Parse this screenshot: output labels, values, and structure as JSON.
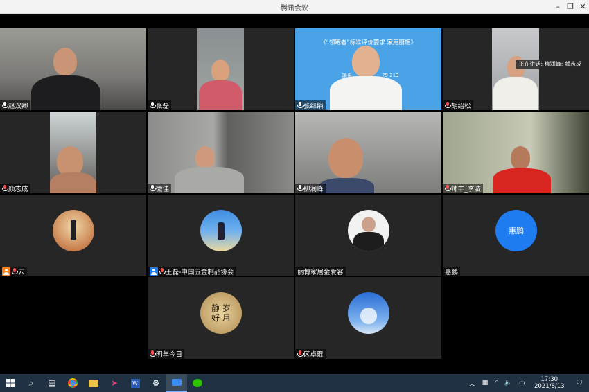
{
  "window": {
    "title": "腾讯会议"
  },
  "speaking_tip": "正在讲话: 柳润峰; 颜志成",
  "slide_text": "《“领跑者”标准评价要求 家用厨柜》",
  "slide_subtext": "腾讯",
  "slide_code": "79 213",
  "participants": [
    {
      "name": "赵汉卿"
    },
    {
      "name": "张磊"
    },
    {
      "name": "张继娟"
    },
    {
      "name": "胡绍松"
    },
    {
      "name": "颜志成"
    },
    {
      "name": "微佳"
    },
    {
      "name": "柳润峰"
    },
    {
      "name": "帅丰_李波"
    },
    {
      "name": "云"
    },
    {
      "name": "王磊-中国五金制品协会"
    },
    {
      "name": "丽博家居金爱容"
    },
    {
      "name": "惠鹏",
      "avatar_text": "惠鹏"
    },
    {
      "name": "明年今日",
      "avatar_text": "静 岁 好 月"
    },
    {
      "name": "区卓琨"
    }
  ],
  "taskbar": {
    "ime": "中",
    "time": "17:30",
    "date": "2021/8/13"
  },
  "colors": {
    "titlebar": "#f3f3f3",
    "taskbar": "#1f3142",
    "avatar_blue": "#1f7cf0",
    "slide_blue": "#4aa3e6"
  }
}
